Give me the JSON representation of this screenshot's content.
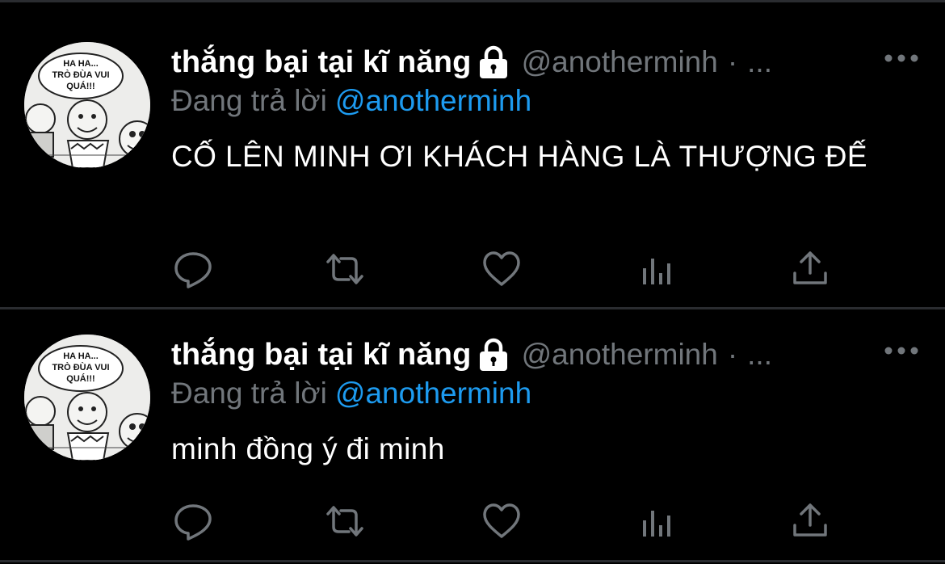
{
  "tweets": [
    {
      "display_name": "thắng bại tại kĩ năng",
      "handle": "@anotherminh",
      "separator": "·",
      "time": "...",
      "reply_prefix": "Đang trả lời",
      "reply_to": "@anotherminh",
      "text": "CỐ LÊN MINH ƠI KHÁCH HÀNG LÀ THƯỢNG ĐẾ",
      "avatar_text": [
        "HA HA...",
        "TRÒ ĐÙA VUI",
        "QUÁ!!!"
      ]
    },
    {
      "display_name": "thắng bại tại kĩ năng",
      "handle": "@anotherminh",
      "separator": "·",
      "time": "...",
      "reply_prefix": "Đang trả lời",
      "reply_to": "@anotherminh",
      "text": "minh đồng ý đi minh",
      "avatar_text": [
        "HA HA...",
        "TRÒ ĐÙA VUI",
        "QUÁ!!!"
      ]
    }
  ],
  "icons": {
    "lock": "lock-icon",
    "more": "more-icon",
    "reply": "reply-icon",
    "retweet": "retweet-icon",
    "like": "like-icon",
    "views": "views-icon",
    "share": "share-icon"
  },
  "colors": {
    "background": "#000000",
    "text": "#ffffff",
    "muted": "#71767b",
    "link": "#1d9bf0",
    "divider": "#2a2c30"
  }
}
